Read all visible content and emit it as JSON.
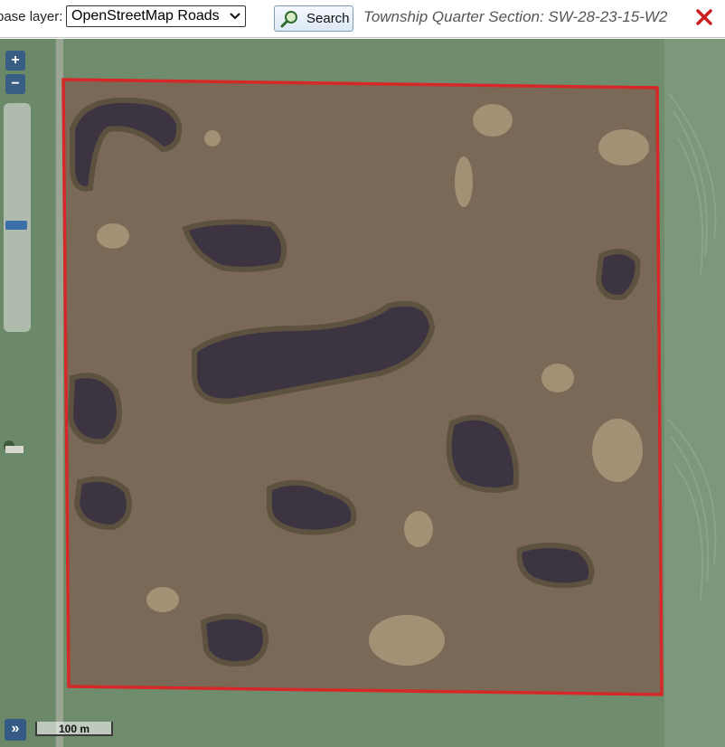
{
  "toolbar": {
    "base_layer_label": "base layer:",
    "base_layer_value": "OpenStreetMap Roads",
    "search_label": "Search",
    "section_title": "Township Quarter Section: SW-28-23-15-W2"
  },
  "map": {
    "zoom_in": "+",
    "zoom_out": "−",
    "zoom_level_fraction": 0.3,
    "expand_label": "»",
    "scale_label": "100 m",
    "boundary_color": "#d62828",
    "icons": {
      "search": "magnifier-icon",
      "close": "close-x-icon"
    }
  },
  "colors": {
    "field": "#7a6a58",
    "water": "#3a3240",
    "grass": "#6e8a6a",
    "close": "#cc2020",
    "button_accent": "#3c6fa8"
  }
}
